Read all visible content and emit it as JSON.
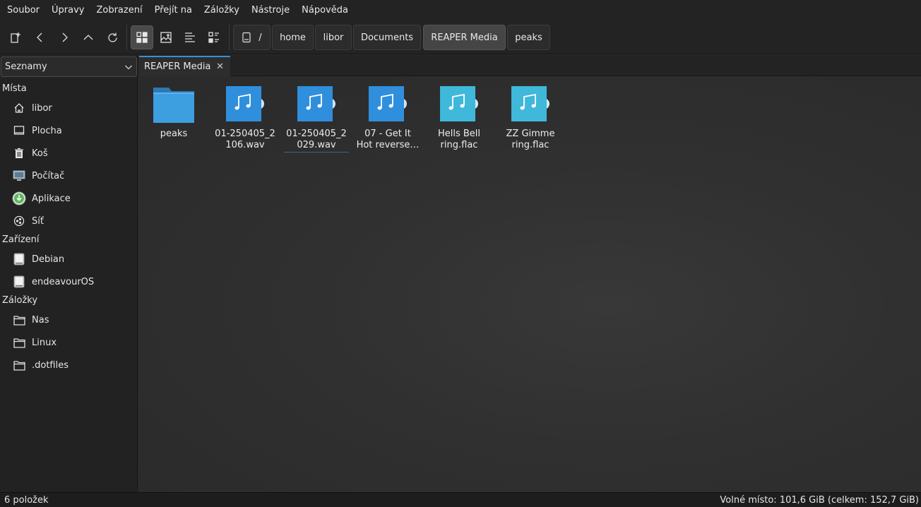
{
  "menubar": {
    "items": [
      "Soubor",
      "Úpravy",
      "Zobrazení",
      "Přejít na",
      "Záložky",
      "Nástroje",
      "Nápověda"
    ]
  },
  "toolbar": {
    "buttons": [
      "new-tab-icon",
      "back-icon",
      "forward-icon",
      "up-icon",
      "reload-icon",
      "icon-view-icon",
      "thumbnail-view-icon",
      "compact-view-icon",
      "detail-view-icon"
    ],
    "active_view": "icon-view"
  },
  "breadcrumb": {
    "root": "/",
    "items": [
      "home",
      "libor",
      "Documents",
      "REAPER Media",
      "peaks"
    ],
    "current": "REAPER Media"
  },
  "sidebar": {
    "combo_value": "Seznamy",
    "sections": [
      {
        "title": "Místa",
        "items": [
          {
            "label": "libor",
            "icon": "home-icon"
          },
          {
            "label": "Plocha",
            "icon": "desktop-icon"
          },
          {
            "label": "Koš",
            "icon": "trash-icon"
          },
          {
            "label": "Počítač",
            "icon": "computer-icon"
          },
          {
            "label": "Aplikace",
            "icon": "applications-icon"
          },
          {
            "label": "Síť",
            "icon": "network-icon"
          }
        ]
      },
      {
        "title": "Zařízení",
        "items": [
          {
            "label": "Debian",
            "icon": "drive-icon"
          },
          {
            "label": "endeavourOS",
            "icon": "drive-icon"
          }
        ]
      },
      {
        "title": "Záložky",
        "items": [
          {
            "label": "Nas",
            "icon": "folder-icon"
          },
          {
            "label": "Linux",
            "icon": "folder-icon"
          },
          {
            "label": ".dotfiles",
            "icon": "folder-icon"
          }
        ]
      }
    ]
  },
  "tab": {
    "label": "REAPER Media"
  },
  "files": [
    {
      "type": "folder",
      "name_line1": "peaks",
      "name_line2": ""
    },
    {
      "type": "audio-wav",
      "name_line1": "01-250405_2",
      "name_line2": "106.wav"
    },
    {
      "type": "audio-wav",
      "name_line1": "01-250405_2",
      "name_line2": "029.wav"
    },
    {
      "type": "audio-wav",
      "name_line1": "07 - Get It",
      "name_line2": "Hot reverse…"
    },
    {
      "type": "audio-flac",
      "name_line1": "Hells Bell",
      "name_line2": "ring.flac"
    },
    {
      "type": "audio-flac",
      "name_line1": "ZZ Gimme",
      "name_line2": "ring.flac"
    }
  ],
  "colors": {
    "accent": "#3a8fd0",
    "folder": "#3d9ee0",
    "wav": "#2f8fdc",
    "flac": "#3fb8da"
  },
  "status": {
    "items_count": "6 položek",
    "free_space": "Volné místo: 101,6 GiB (celkem: 152,7 GiB)"
  }
}
